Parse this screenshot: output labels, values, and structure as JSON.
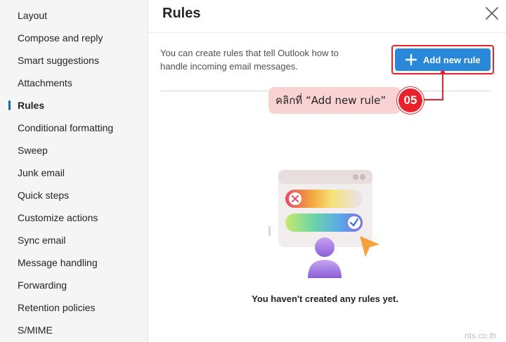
{
  "sidebar": {
    "items": [
      {
        "label": "Layout"
      },
      {
        "label": "Compose and reply"
      },
      {
        "label": "Smart suggestions"
      },
      {
        "label": "Attachments"
      },
      {
        "label": "Rules"
      },
      {
        "label": "Conditional formatting"
      },
      {
        "label": "Sweep"
      },
      {
        "label": "Junk email"
      },
      {
        "label": "Quick steps"
      },
      {
        "label": "Customize actions"
      },
      {
        "label": "Sync email"
      },
      {
        "label": "Message handling"
      },
      {
        "label": "Forwarding"
      },
      {
        "label": "Retention policies"
      },
      {
        "label": "S/MIME"
      }
    ],
    "active_item": "Rules"
  },
  "panel": {
    "title": "Rules",
    "description": "You can create rules that tell Outlook how to handle incoming email messages.",
    "add_button_label": "Add new rule",
    "empty_state": "You haven't created any rules yet."
  },
  "annotation": {
    "callout_text": "คลิกที่ “Add new rule”",
    "step_number": "05",
    "highlight_color": "#e8212c"
  },
  "watermark": "nts.co.th",
  "colors": {
    "accent": "#2a88d8",
    "active_indicator": "#0f6cbd",
    "annotation_red": "#e8212c",
    "callout_bg": "#f9d3d3"
  }
}
